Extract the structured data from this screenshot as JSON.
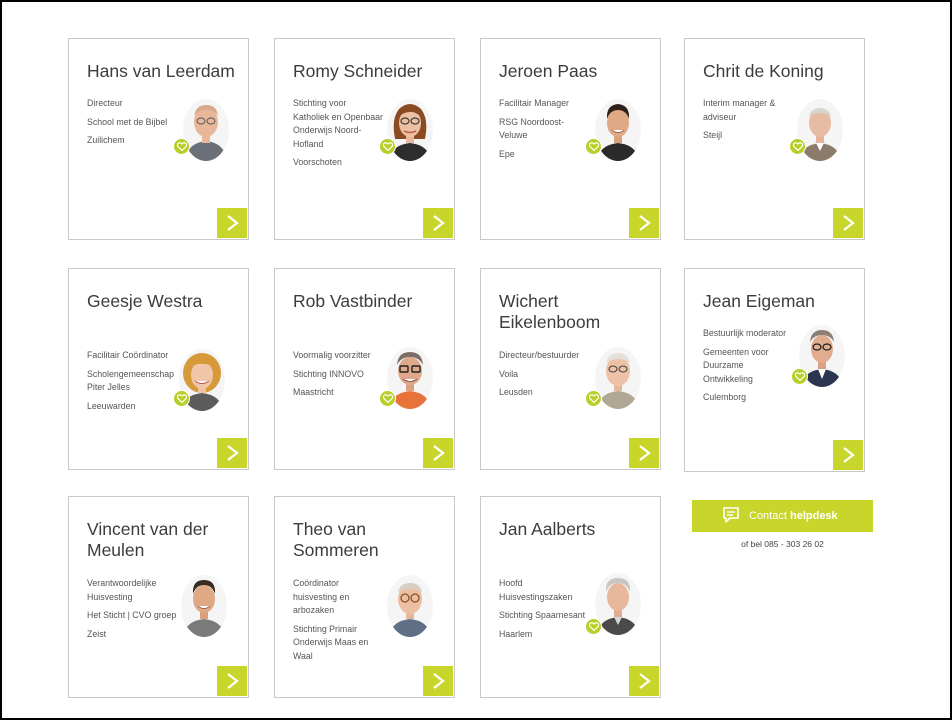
{
  "cards": [
    {
      "name": "Hans van Leerdam",
      "role": "Directeur",
      "org": "School met de Bijbel",
      "location": "Zuilichem",
      "photo": "bald-man-glasses",
      "heart": true
    },
    {
      "name": "Romy Schneider",
      "role": "",
      "org": "Stichting voor Katholiek en Openbaar Onderwijs Noord-Hofland",
      "location": "Voorschoten",
      "photo": "woman-brown-hair-glasses",
      "heart": true
    },
    {
      "name": "Jeroen Paas",
      "role": "Facilitair Manager",
      "org": "RSG Noordoost-Veluwe",
      "location": "Epe",
      "photo": "young-man-dark-hair",
      "heart": true
    },
    {
      "name": "Chrit de Koning",
      "role": "Interim manager & adviseur",
      "org": "",
      "location": "Steijl",
      "photo": "older-bald-man",
      "heart": true
    },
    {
      "name": "Geesje Westra",
      "role": "Facilitair Coördinator",
      "org": "Scholengemeenschap Piter Jelles",
      "location": "Leeuwarden",
      "photo": "woman-blonde-curly",
      "heart": true
    },
    {
      "name": "Rob Vastbinder",
      "role": "Voormalig voorzitter",
      "org": "Stichting INNOVO",
      "location": "Maastricht",
      "photo": "man-grey-hair-glasses",
      "heart": true
    },
    {
      "name": "Wichert Eikelenboom",
      "role": "Directeur/bestuurder",
      "org": "Voila",
      "location": "Leusden",
      "photo": "older-man-glasses",
      "heart": true
    },
    {
      "name": "Jean Eigeman",
      "role": "Bestuurlijk moderator",
      "org": "Gemeenten voor Duurzame Ontwikkeling",
      "location": "Culemborg",
      "photo": "man-glasses-suit",
      "heart": true
    },
    {
      "name": "Vincent van der Meulen",
      "role": "Verantwoordelijke Huisvesting",
      "org": "Het Sticht | CVO groep",
      "location": "Zeist",
      "photo": "man-dark-hair-smiling",
      "heart": false
    },
    {
      "name": "Theo van Sommeren",
      "role": "Coördinator huisvesting en arbozaken",
      "org": "Stichting Primair Onderwijs Maas en Waal",
      "location": "",
      "photo": "bald-man-round-glasses",
      "heart": false
    },
    {
      "name": "Jan Aalberts",
      "role": "Hoofd Huisvestingszaken",
      "org": "Stichting Spaarnesant",
      "location": "Haarlem",
      "photo": "older-man-grey-hair",
      "heart": true
    }
  ],
  "helpdesk": {
    "label_prefix": "Contact",
    "label_bold": "helpdesk",
    "icon": "chat-bubble-icon",
    "phone_text": "of bel 085 - 303 26 02"
  },
  "colors": {
    "accent": "#c8d62c",
    "heart": "#b8ce2a",
    "card_border": "#c9c9c9",
    "text": "#4a4a4a"
  },
  "icons": {
    "card_arrow": "chevron-right-icon",
    "badge": "heart-icon"
  }
}
